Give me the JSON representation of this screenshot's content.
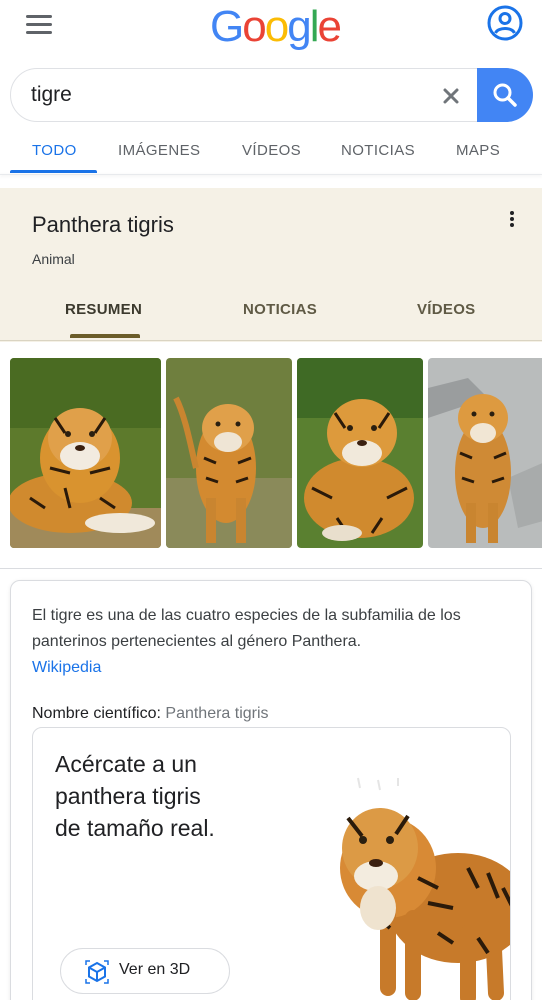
{
  "header": {
    "menu_icon": "hamburger-menu-icon",
    "logo": [
      "G",
      "o",
      "o",
      "g",
      "l",
      "e"
    ],
    "logo_colors": [
      "#4285F4",
      "#EA4335",
      "#FBBC05",
      "#4285F4",
      "#34A853",
      "#EA4335"
    ],
    "account_icon": "account-circle-icon"
  },
  "search": {
    "query": "tigre",
    "clear_icon": "close-icon",
    "search_icon": "search-icon",
    "accent": "#4285F4"
  },
  "top_tabs": {
    "items": [
      "TODO",
      "IMÁGENES",
      "VÍDEOS",
      "NOTICIAS",
      "MAPS"
    ],
    "active": "TODO",
    "active_color": "#1a73e8"
  },
  "knowledge_panel": {
    "title": "Panthera tigris",
    "subtitle": "Animal",
    "more_icon": "more-vert-icon",
    "background": "#f5f1e6",
    "tabs": [
      "RESUMEN",
      "NOTICIAS",
      "VÍDEOS"
    ],
    "active_tab": "RESUMEN"
  },
  "images": {
    "count_visible": 4,
    "subject": "tiger photos"
  },
  "description": {
    "text": "El tigre es una de las cuatro especies de la subfamilia de los panterinos pertenecientes al género Panthera.",
    "source": "Wikipedia",
    "sci_label": "Nombre científico:",
    "sci_value": "Panthera tigris"
  },
  "ar_card": {
    "line1": "Acércate a un",
    "line2": "panthera tigris",
    "line3": "de tamaño real.",
    "button_label": "Ver en 3D",
    "button_icon": "view-in-ar-cube-icon"
  }
}
